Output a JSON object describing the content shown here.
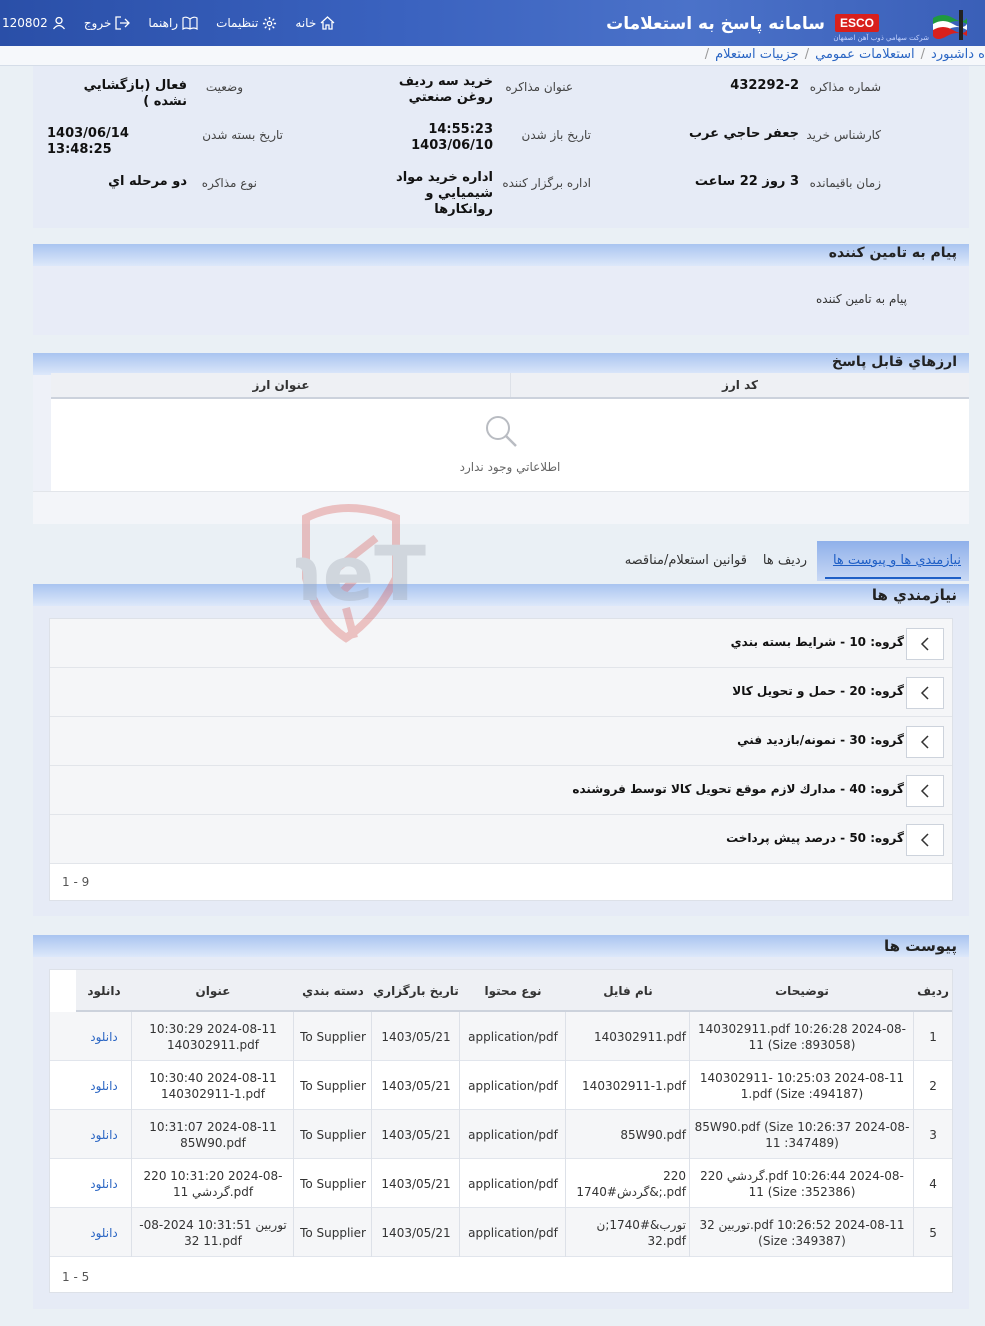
{
  "header": {
    "app_title": "سامانه پاسخ به استعلامات",
    "logo_text": "ESCO",
    "logo_subtitle": "شركت سهامي ذوب آهن اصفهان",
    "nav": {
      "user_id": "120802",
      "exit": "خروج",
      "help": "راهنما",
      "settings": "تنظيمات",
      "home": "خانه"
    }
  },
  "breadcrumb": {
    "items": [
      "ه داشبورد",
      "استعلامات عمومي",
      "جزييات استعلام"
    ],
    "sep": "/"
  },
  "info": {
    "fields": [
      {
        "label": "شماره مذاكره",
        "value": "432292-2"
      },
      {
        "label": "عنوان مذاكره",
        "value": "خريد سه رديف روغن صنعتي"
      },
      {
        "label": "وضعيت",
        "value": "فعال (بازگشايي نشده )"
      },
      {
        "label": "كارشناس خريد",
        "value": "جعفر حاجي عرب"
      },
      {
        "label": "تاريخ باز شدن",
        "value": "14:55:23 1403/06/10"
      },
      {
        "label": "تاريخ بسته شدن",
        "value": "1403/06/14 13:48:25"
      },
      {
        "label": "زمان باقيمانده",
        "value": "3 روز 22 ساعت"
      },
      {
        "label": "اداره برگزار كننده",
        "value": "اداره خريد مواد شيميايي و روانكارها"
      },
      {
        "label": "نوع مذاكره",
        "value": "دو مرحله اي"
      }
    ]
  },
  "supplier_message": {
    "title": "پيام به تامين كننده",
    "text": "پيام به تامين كننده"
  },
  "currencies": {
    "title": "ارزهاي قابل پاسخ",
    "columns": [
      "كد ارز",
      "عنوان ارز"
    ],
    "empty_text": "اطلاعاتي وجود ندارد"
  },
  "tabs": [
    "نيازمندي ها و پيوست ها",
    "رديف ها",
    "قوانين استعلام/مناقصه"
  ],
  "requirements": {
    "title": "نيازمندي ها",
    "groups": [
      "گروه: 10 - شرايط بسته بندي",
      "گروه: 20 - حمل و تحويل كالا",
      "گروه: 30 - نمونه/بازديد فني",
      "گروه: 40 - مدارك لازم موقع تحويل كالا توسط فروشنده",
      "گروه: 50 - درصد پيش پرداخت"
    ],
    "pager": "1 - 9"
  },
  "attachments": {
    "title": "پيوست ها",
    "columns": [
      "رديف",
      "توضيحات",
      "نام فايل",
      "نوع محتوا",
      "تاريخ بارگزاري",
      "دسته بندي",
      "عنوان",
      "دانلود"
    ],
    "rows": [
      [
        "1",
        "140302911.pdf 10:26:28 2024-08-11 (Size :893058)",
        "140302911.pdf",
        "application/pdf",
        "1403/05/21",
        "To Supplier",
        "10:30:29 2024-08-11 140302911.pdf",
        "دانلود"
      ],
      [
        "2",
        "140302911- 10:25:03 2024-08-11 1.pdf (Size :494187)",
        "140302911-1.pdf",
        "application/pdf",
        "1403/05/21",
        "To Supplier",
        "10:30:40 2024-08-11 140302911-1.pdf",
        "دانلود"
      ],
      [
        "3",
        "85W90.pdf (Size 10:26:37 2024-08-11 :347489)",
        "85W90.pdf",
        "application/pdf",
        "1403/05/21",
        "To Supplier",
        "10:31:07 2024-08-11 85W90.pdf",
        "دانلود"
      ],
      [
        "4",
        "220 گردشي.pdf 10:26:44 2024-08-11 (Size :352386)",
        "220 گردش#1740&;.pdf",
        "application/pdf",
        "1403/05/21",
        "To Supplier",
        "220 10:31:20 2024-08-11 گردشي.pdf",
        "دانلود"
      ],
      [
        "5",
        "توربين 32.pdf 10:26:52 2024-08-11 (Size :349387)",
        "تورب&#1740;ن 32.pdf",
        "application/pdf",
        "1403/05/21",
        "To Supplier",
        "توربين 10:31:51 2024-08-11 32.pdf",
        "دانلود"
      ]
    ],
    "pager": "1 - 5"
  },
  "watermark_text": "AriaTender.neT",
  "colors": {
    "header_bg": "#3a62bf",
    "link": "#2b66c4",
    "panel_head": "#a9c4f0",
    "esco_red": "#d8201c"
  }
}
